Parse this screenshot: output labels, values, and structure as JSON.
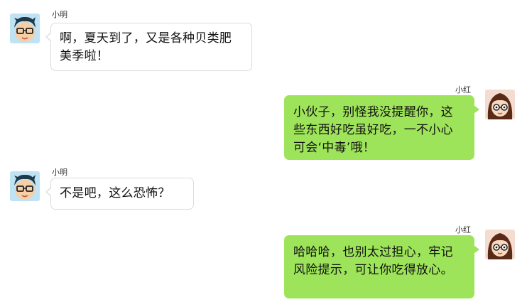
{
  "colors": {
    "incoming_bubble": "#ffffff",
    "outgoing_bubble": "#9ee45a",
    "incoming_border": "#dcdcdc"
  },
  "messages": [
    {
      "sender": "小明",
      "side": "left",
      "avatar": "boy-avatar-icon",
      "text": "啊，夏天到了，又是各种贝类肥美季啦！"
    },
    {
      "sender": "小红",
      "side": "right",
      "avatar": "girl-avatar-icon",
      "text": "小伙子，别怪我没提醒你，这些东西好吃虽好吃，一不小心可会‘中毒’哦！"
    },
    {
      "sender": "小明",
      "side": "left",
      "avatar": "boy-avatar-icon",
      "text": "不是吧，这么恐怖？"
    },
    {
      "sender": "小红",
      "side": "right",
      "avatar": "girl-avatar-icon",
      "text": "哈哈哈，也别太过担心，牢记风险提示，可让你吃得放心。"
    }
  ]
}
